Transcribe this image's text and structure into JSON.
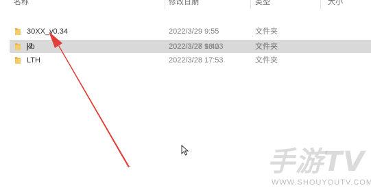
{
  "header": {
    "columns": [
      {
        "label": "名称"
      },
      {
        "label": "修改日期"
      },
      {
        "label": "类型"
      },
      {
        "label": "大小"
      }
    ]
  },
  "files": [
    {
      "name": "30XX_v0.34",
      "date": "2022/3/29 9:55",
      "type": "文件夹",
      "selected": false
    },
    {
      "name": "j7",
      "date": "2022/3/28 18:23",
      "type": "文件夹",
      "selected": true
    },
    {
      "name": "kb",
      "date": "2022/3/27 9:40",
      "type": "文件夹",
      "selected": false
    },
    {
      "name": "LTH",
      "date": "2022/3/28 17:53",
      "type": "文件夹",
      "selected": false
    }
  ],
  "annotation": {
    "arrow_color": "#e0403a"
  },
  "watermark": {
    "logo": "手游TV",
    "url": "WWW.SHOUYOUTV.COM"
  },
  "colors": {
    "folder": "#e8b64a",
    "selected_row": "#d9d9d9"
  }
}
